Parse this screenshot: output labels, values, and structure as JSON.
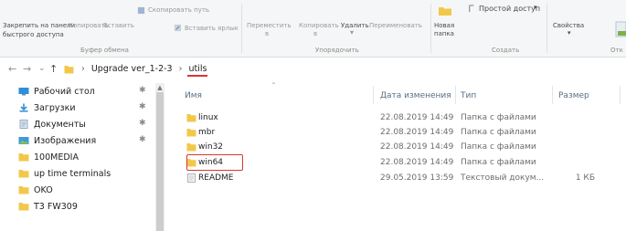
{
  "ribbon": {
    "clipboard": {
      "pin_quick_access": [
        "Закрепить на панели",
        "быстрого доступа"
      ],
      "copy": "Копировать",
      "paste": "Вставить",
      "copy_path": "Скопировать путь",
      "paste_shortcut": "Вставить ярлык",
      "group_label": "Буфер обмена"
    },
    "organize": {
      "move_to": "Переместить",
      "copy_to": "Копировать",
      "move_to_sub": "в",
      "copy_to_sub": "в",
      "delete": "Удалить",
      "rename": "Переименовать",
      "group_label": "Упорядочить"
    },
    "create": {
      "new_folder": [
        "Новая",
        "папка"
      ],
      "easy_access": "Простой доступ",
      "group_label": "Создать"
    },
    "open": {
      "properties": "Свойства",
      "group_label": "Отк"
    }
  },
  "address_bar": {
    "back": "←",
    "forward": "→",
    "recent": "⌄",
    "up": "↑",
    "path": [
      "Upgrade ver_1-2-3",
      "utils"
    ]
  },
  "nav_pane": {
    "items": [
      {
        "label": "Рабочий стол",
        "icon": "desktop-icon",
        "pinned": true
      },
      {
        "label": "Загрузки",
        "icon": "downloads-icon",
        "pinned": true
      },
      {
        "label": "Документы",
        "icon": "documents-icon",
        "pinned": true
      },
      {
        "label": "Изображения",
        "icon": "pictures-icon",
        "pinned": true
      },
      {
        "label": "100MEDIA",
        "icon": "folder-icon",
        "pinned": false
      },
      {
        "label": "up time terminals",
        "icon": "folder-icon",
        "pinned": false
      },
      {
        "label": "OKO",
        "icon": "folder-icon",
        "pinned": false
      },
      {
        "label": "T3 FW309",
        "icon": "folder-icon",
        "pinned": false
      }
    ],
    "pin_glyph": "✱"
  },
  "file_list": {
    "columns": {
      "name": "Имя",
      "date": "Дата изменения",
      "type": "Тип",
      "size": "Размер"
    },
    "rows": [
      {
        "name": "linux",
        "date": "22.08.2019 14:49",
        "type": "Папка с файлами",
        "size": "",
        "icon": "folder-icon"
      },
      {
        "name": "mbr",
        "date": "22.08.2019 14:49",
        "type": "Папка с файлами",
        "size": "",
        "icon": "folder-icon"
      },
      {
        "name": "win32",
        "date": "22.08.2019 14:49",
        "type": "Папка с файлами",
        "size": "",
        "icon": "folder-icon"
      },
      {
        "name": "win64",
        "date": "22.08.2019 14:49",
        "type": "Папка с файлами",
        "size": "",
        "icon": "folder-icon"
      },
      {
        "name": "README",
        "date": "29.05.2019 13:59",
        "type": "Текстовый докум...",
        "size": "1 КБ",
        "icon": "text-file-icon"
      }
    ]
  },
  "colors": {
    "folder": "#f2c84b",
    "highlight": "#d9372f",
    "header_text": "#5a6e82"
  }
}
